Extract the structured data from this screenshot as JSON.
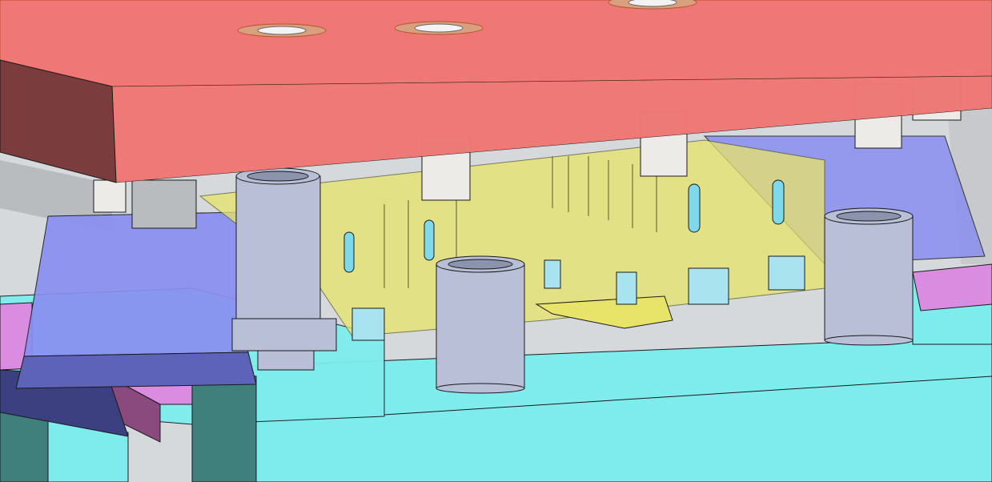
{
  "scene": {
    "kind": "cad-mold-assembly-3d-view",
    "colors": {
      "background": "#d6d9dc",
      "top_plate": "#ef7876",
      "top_plate_side": "#7b3c3e",
      "base_block": "#7eecec",
      "base_block_side": "#3f807d",
      "blue_blocks": "#8a8ff0",
      "yellow_insert": "#e8e46a",
      "magenta_plates": "#d98ce0",
      "guide_bushings": "#b8bfd6",
      "ejector_pins": "#ecebe8",
      "edge": "#1a1a1a"
    }
  }
}
